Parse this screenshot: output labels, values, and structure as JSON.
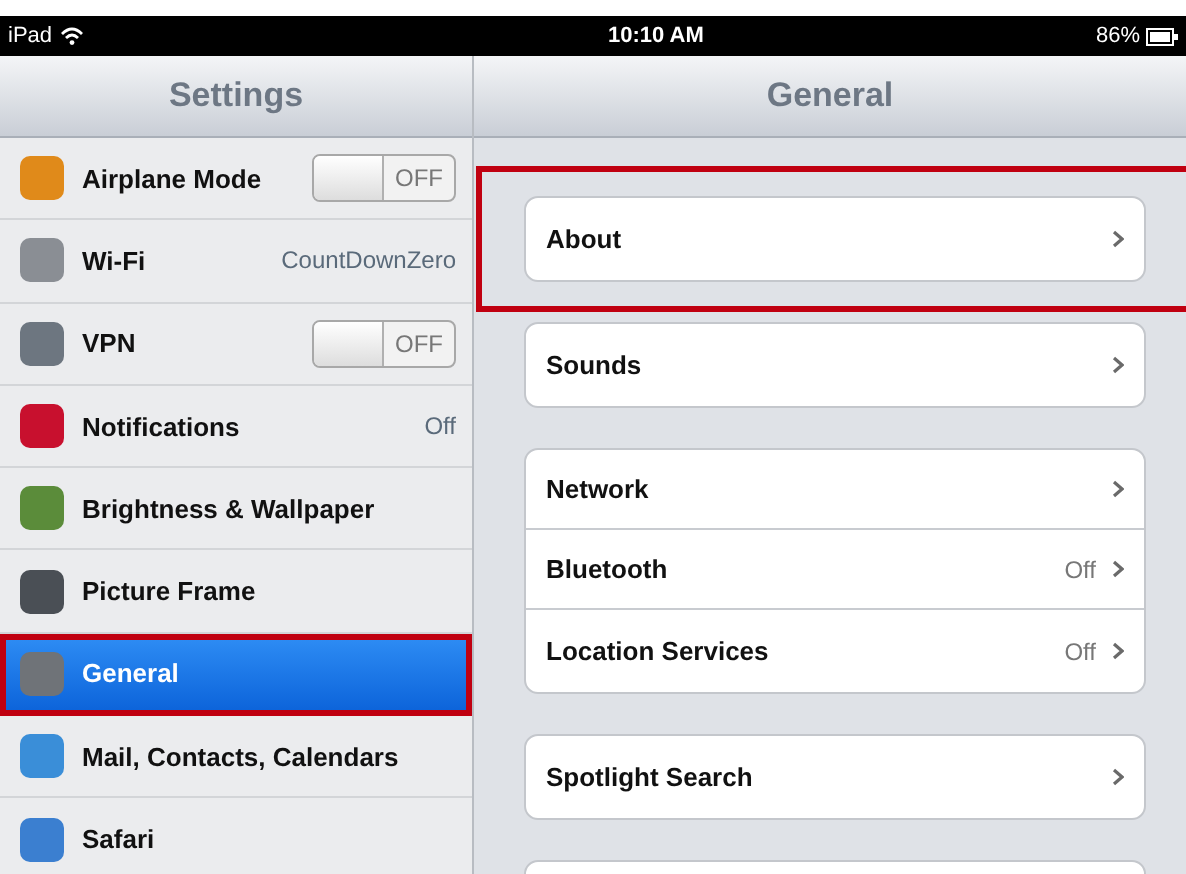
{
  "status_bar": {
    "device": "iPad",
    "time": "10:10 AM",
    "battery": "86%"
  },
  "sidebar": {
    "title": "Settings",
    "items": [
      {
        "label": "Airplane Mode",
        "kind": "switch",
        "value": "OFF",
        "on": false,
        "selected": false,
        "highlighted": false
      },
      {
        "label": "Wi-Fi",
        "kind": "value",
        "value": "CountDownZero",
        "selected": false,
        "highlighted": false
      },
      {
        "label": "VPN",
        "kind": "switch",
        "value": "OFF",
        "on": false,
        "selected": false,
        "highlighted": false
      },
      {
        "label": "Notifications",
        "kind": "value",
        "value": "Off",
        "selected": false,
        "highlighted": false
      },
      {
        "label": "Brightness & Wallpaper",
        "kind": "plain",
        "selected": false,
        "highlighted": false
      },
      {
        "label": "Picture Frame",
        "kind": "plain",
        "selected": false,
        "highlighted": false
      },
      {
        "label": "General",
        "kind": "plain",
        "selected": true,
        "highlighted": true
      },
      {
        "label": "Mail, Contacts, Calendars",
        "kind": "plain",
        "selected": false,
        "highlighted": false
      },
      {
        "label": "Safari",
        "kind": "plain",
        "selected": false,
        "highlighted": false
      }
    ]
  },
  "detail": {
    "title": "General",
    "groups": [
      {
        "highlighted": true,
        "rows": [
          {
            "label": "About"
          }
        ]
      },
      {
        "highlighted": false,
        "rows": [
          {
            "label": "Sounds"
          }
        ]
      },
      {
        "highlighted": false,
        "rows": [
          {
            "label": "Network"
          },
          {
            "label": "Bluetooth",
            "value": "Off"
          },
          {
            "label": "Location Services",
            "value": "Off"
          }
        ]
      },
      {
        "highlighted": false,
        "rows": [
          {
            "label": "Spotlight Search"
          }
        ]
      }
    ]
  }
}
